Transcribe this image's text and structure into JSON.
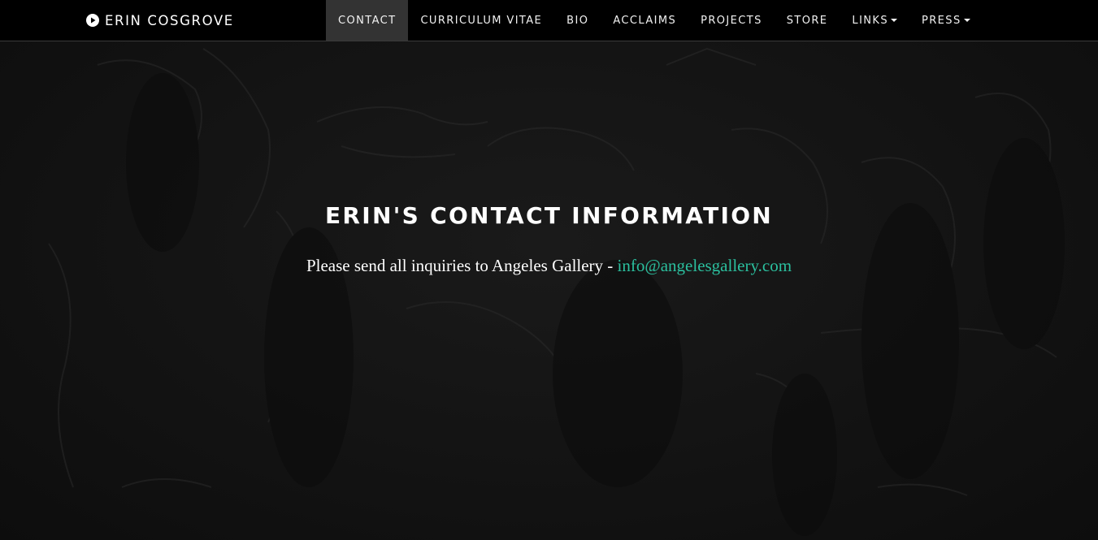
{
  "brand": {
    "name": "ERIN COSGROVE",
    "icon": "play-circle-icon"
  },
  "nav": {
    "items": [
      {
        "label": "CONTACT",
        "active": true
      },
      {
        "label": "CURRICULUM VITAE"
      },
      {
        "label": "BIO"
      },
      {
        "label": "ACCLAIMS"
      },
      {
        "label": "PROJECTS"
      },
      {
        "label": "STORE"
      },
      {
        "label": "LINKS",
        "dropdown": true
      },
      {
        "label": "PRESS",
        "dropdown": true
      }
    ]
  },
  "main": {
    "title": "ERIN'S CONTACT INFORMATION",
    "inquiry_text": "Please send all inquiries to Angeles Gallery - ",
    "email": "info@angelesgallery.com"
  },
  "colors": {
    "background": "#121212",
    "navbar": "#000000",
    "active_tab": "#333333",
    "link": "#2bbf9e",
    "text": "#ffffff"
  }
}
